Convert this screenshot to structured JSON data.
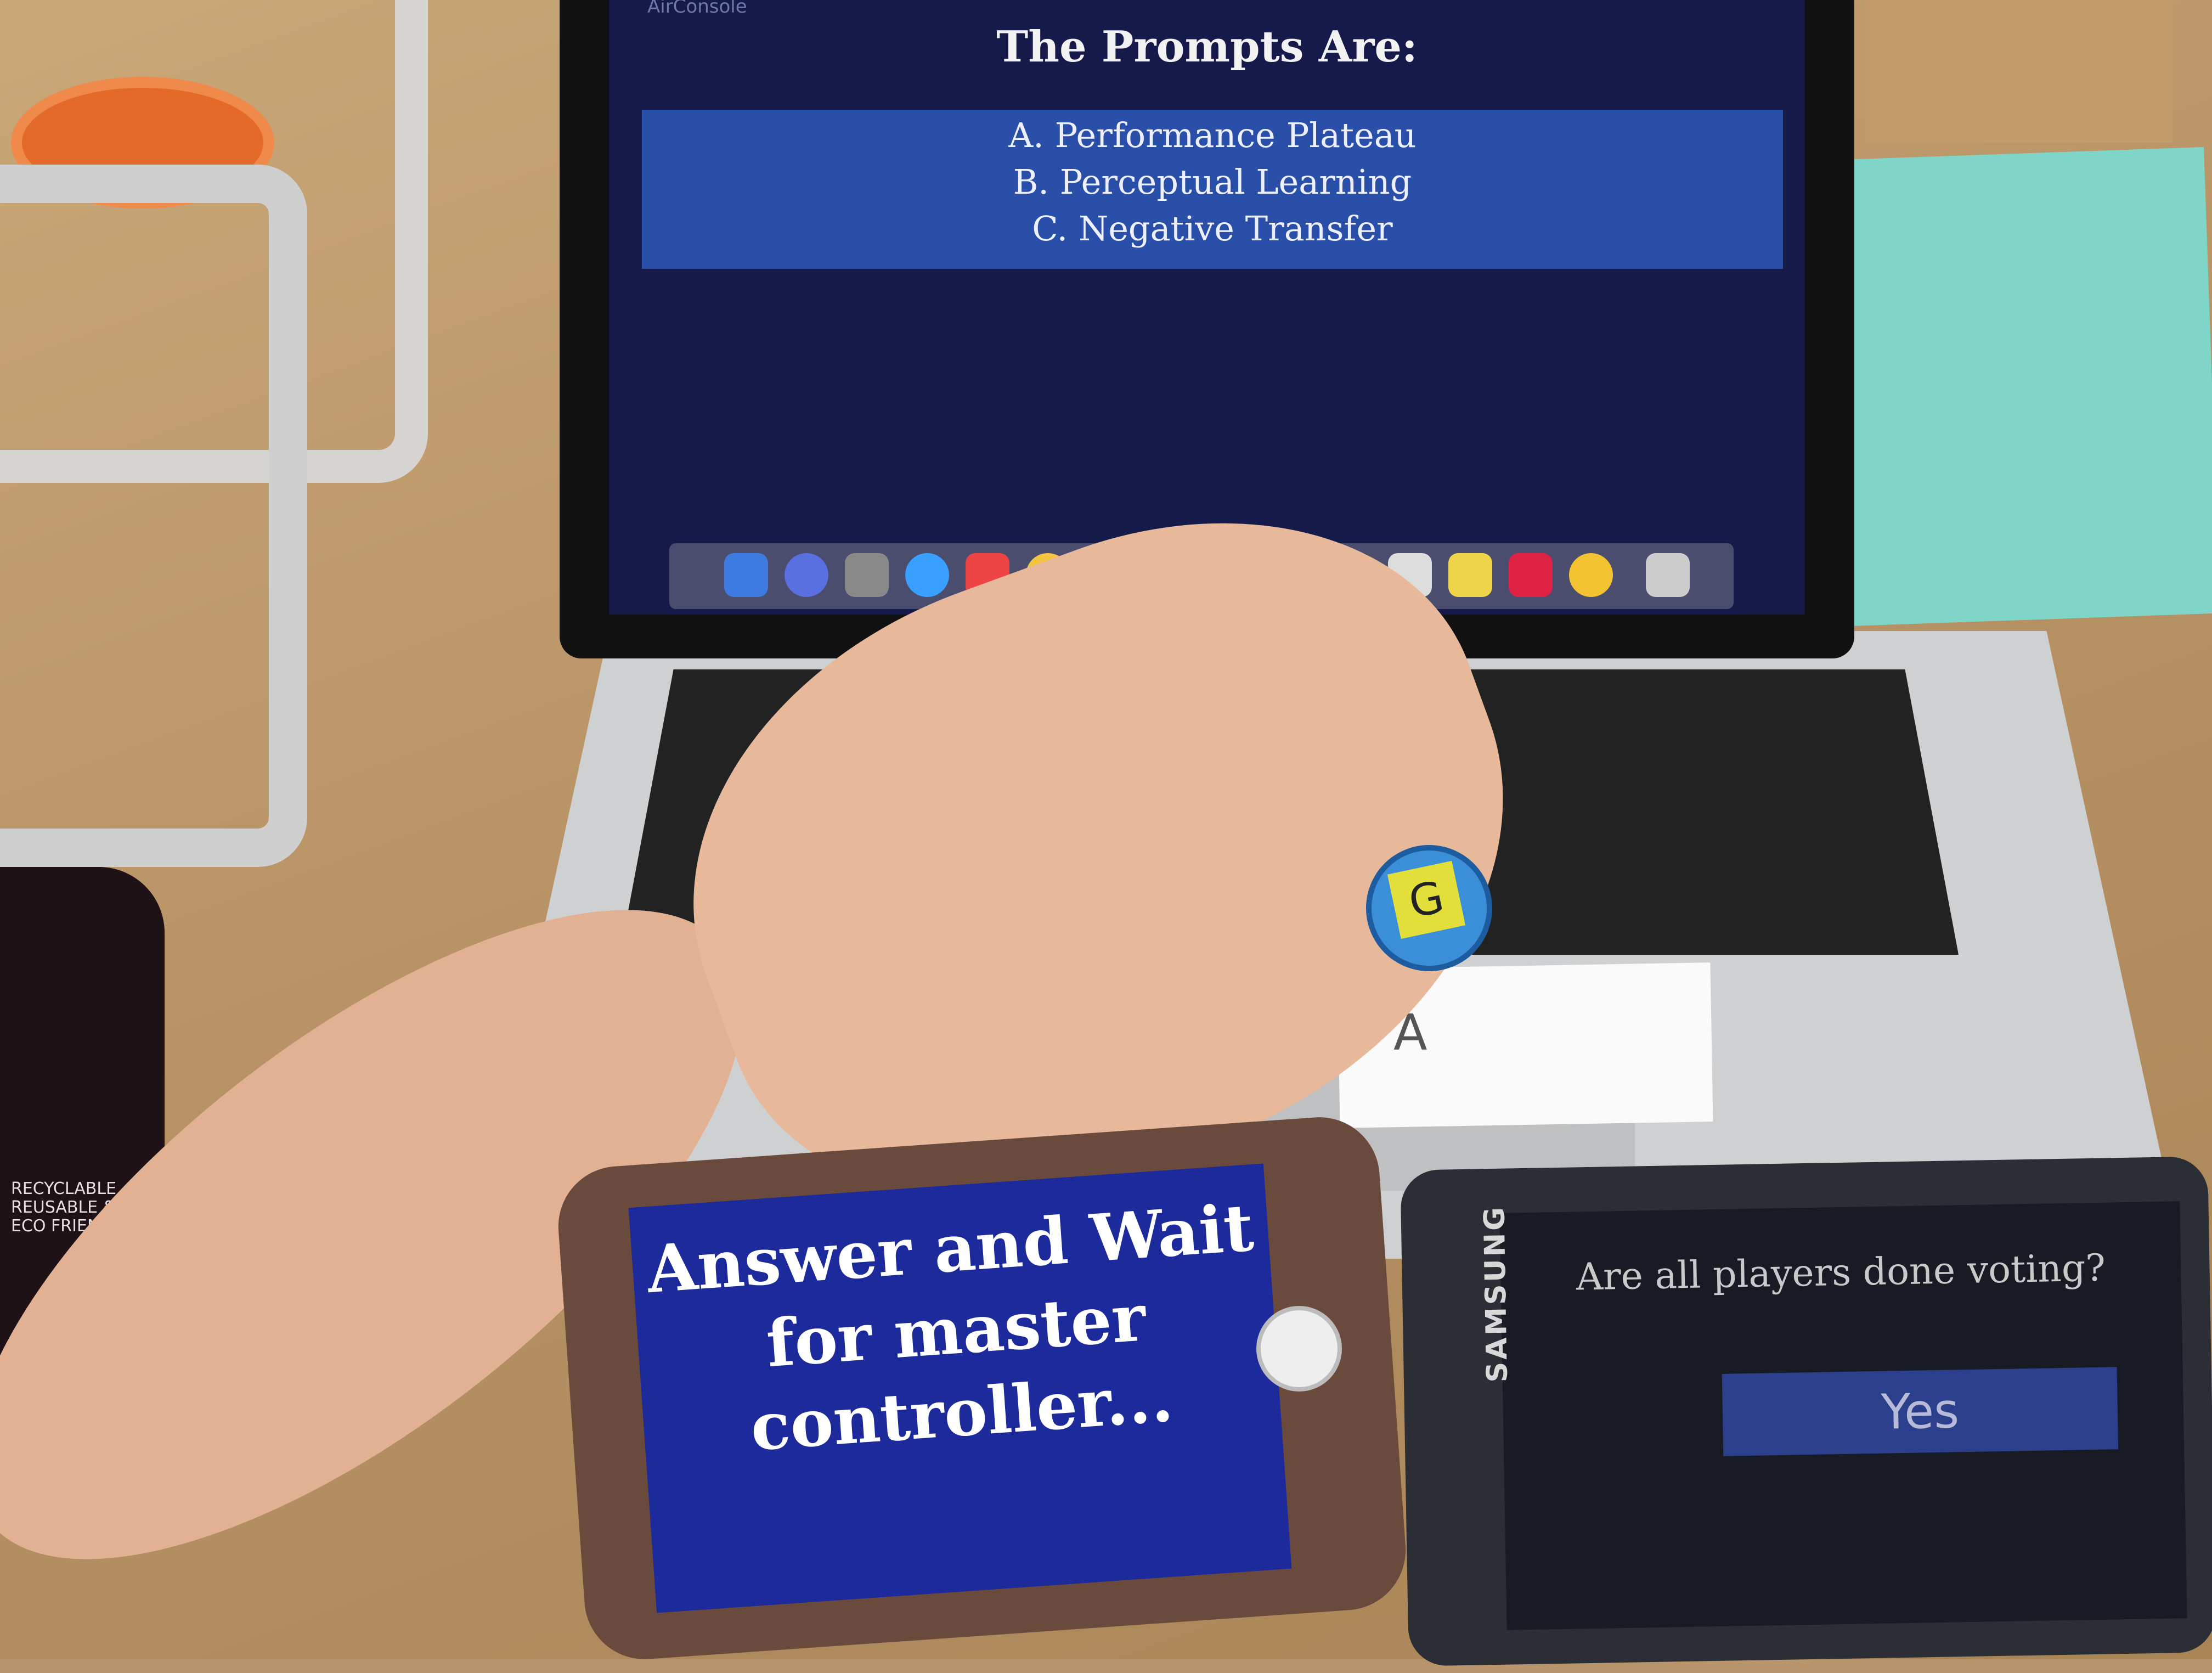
{
  "laptop_screen": {
    "brand": "AirConsole",
    "title": "The Prompts Are:",
    "prompts": [
      "A. Performance Plateau",
      "B. Perceptual Learning",
      "C. Negative Transfer"
    ]
  },
  "token": {
    "label": "G"
  },
  "note": {
    "text": "A"
  },
  "iphone": {
    "message": "Answer and Wait for master controller..."
  },
  "samsung": {
    "brand": "SAMSUNG",
    "question": "Are all players done voting?",
    "yes_button": "Yes"
  },
  "bottle": {
    "text": "RECYCLABLE REUSABLE & ECO FRIENDLY"
  },
  "colors": {
    "laptop_bg": "#161a4a",
    "prompt_band": "#2a4fa8",
    "iphone_bg": "#1c2a9c",
    "samsung_button": "#2b3f8c"
  }
}
